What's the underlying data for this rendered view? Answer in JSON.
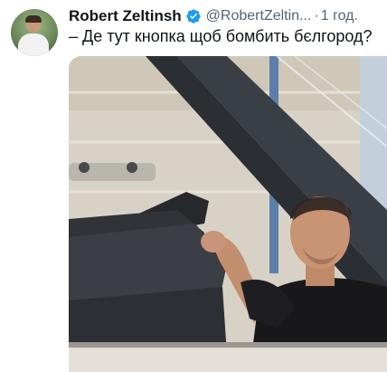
{
  "tweet": {
    "author_name": "Robert Zeltinsh",
    "handle": "@RobertZeltin...",
    "separator": "·",
    "time": "1 год.",
    "text": "– Де тут кнопка щоб бомбить бєлгород?",
    "verified_color": "#1d9bf0"
  },
  "icons": {
    "verified": "verified-badge-icon"
  }
}
